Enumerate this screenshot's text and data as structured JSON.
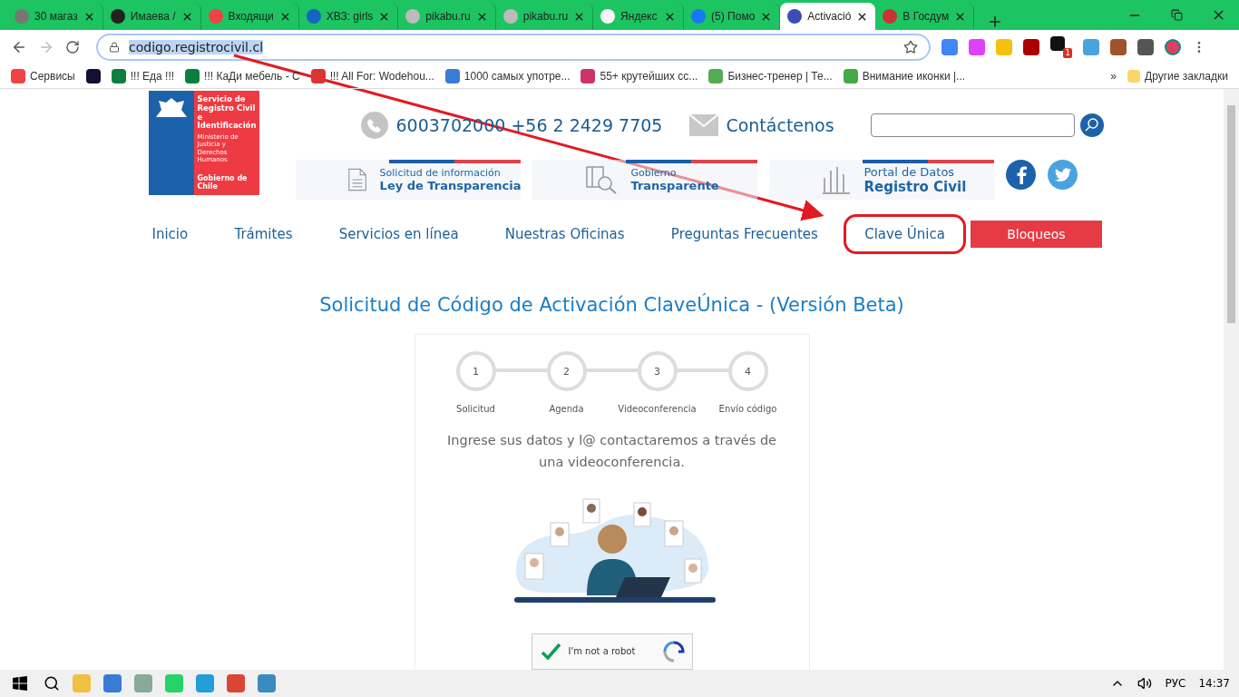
{
  "browser": {
    "tabs": [
      {
        "title": "30 магаз",
        "selected": false
      },
      {
        "title": "Имаева /",
        "selected": false
      },
      {
        "title": "Входящи",
        "selected": false
      },
      {
        "title": "ХВЗ: girls",
        "selected": false
      },
      {
        "title": "pikabu.ru",
        "selected": false
      },
      {
        "title": "pikabu.ru",
        "selected": false
      },
      {
        "title": "Яндекс",
        "selected": false
      },
      {
        "title": "(5) Помо",
        "selected": false
      },
      {
        "title": "Activació",
        "selected": true
      },
      {
        "title": "В Госдум",
        "selected": false
      }
    ],
    "url": "codigo.registrocivil.cl",
    "bookmarks": [
      {
        "kind": "labeled",
        "label": "Сервисы"
      },
      {
        "kind": "icon_only"
      },
      {
        "kind": "labeled",
        "label": "!!! Еда !!!"
      },
      {
        "kind": "labeled",
        "label": "!!! КаДи мебель - С"
      },
      {
        "kind": "labeled",
        "label": "!!! All For: Wodehou..."
      },
      {
        "kind": "labeled",
        "label": "1000 самых употре..."
      },
      {
        "kind": "labeled",
        "label": "55+ крутейших сс..."
      },
      {
        "kind": "labeled",
        "label": "Бизнес-тренер | Те..."
      },
      {
        "kind": "labeled",
        "label": "Внимание иконки |..."
      }
    ],
    "bookmarks_more": "»",
    "other_bookmarks": "Другие закладки",
    "extension_badge": "1"
  },
  "page": {
    "logo": {
      "title": "Servicio de Registro Civil e Identificación",
      "subtitle": "Ministerio de Justicia y Derechos Humanos",
      "footer": "Gobierno de Chile"
    },
    "phone": "6003702000 +56 2 2429 7705",
    "contact": "Contáctenos",
    "banners": [
      {
        "kind": "document",
        "line1": "Solicitud de información",
        "line2": "Ley de Transparencia"
      },
      {
        "kind": "magnifier",
        "line1": "Gobierno",
        "line2": "Transparente"
      },
      {
        "kind": "bars",
        "line1": "Portal de Datos",
        "line2": "Registro Civil"
      }
    ],
    "nav": [
      {
        "label": "Inicio",
        "circled": false
      },
      {
        "label": "Trámites",
        "circled": false
      },
      {
        "label": "Servicios en línea",
        "circled": false
      },
      {
        "label": "Nuestras Oficinas",
        "circled": false
      },
      {
        "label": "Preguntas Frecuentes",
        "circled": false
      },
      {
        "label": "Clave Única",
        "circled": true
      }
    ],
    "nav_button": "Bloqueos",
    "title": "Solicitud de Código de Activación ClaveÚnica - (Versión Beta)",
    "steps": [
      {
        "number": "1",
        "label": "Solicitud"
      },
      {
        "number": "2",
        "label": "Agenda"
      },
      {
        "number": "3",
        "label": "Videoconferencia"
      },
      {
        "number": "4",
        "label": "Envío código"
      }
    ],
    "description": "Ingrese sus datos y l@ contactaremos a través de una videoconferencia.",
    "captcha": {
      "label": "I'm not a robot",
      "checked": true
    }
  },
  "taskbar": {
    "language": "РУС",
    "time": "14:37"
  }
}
